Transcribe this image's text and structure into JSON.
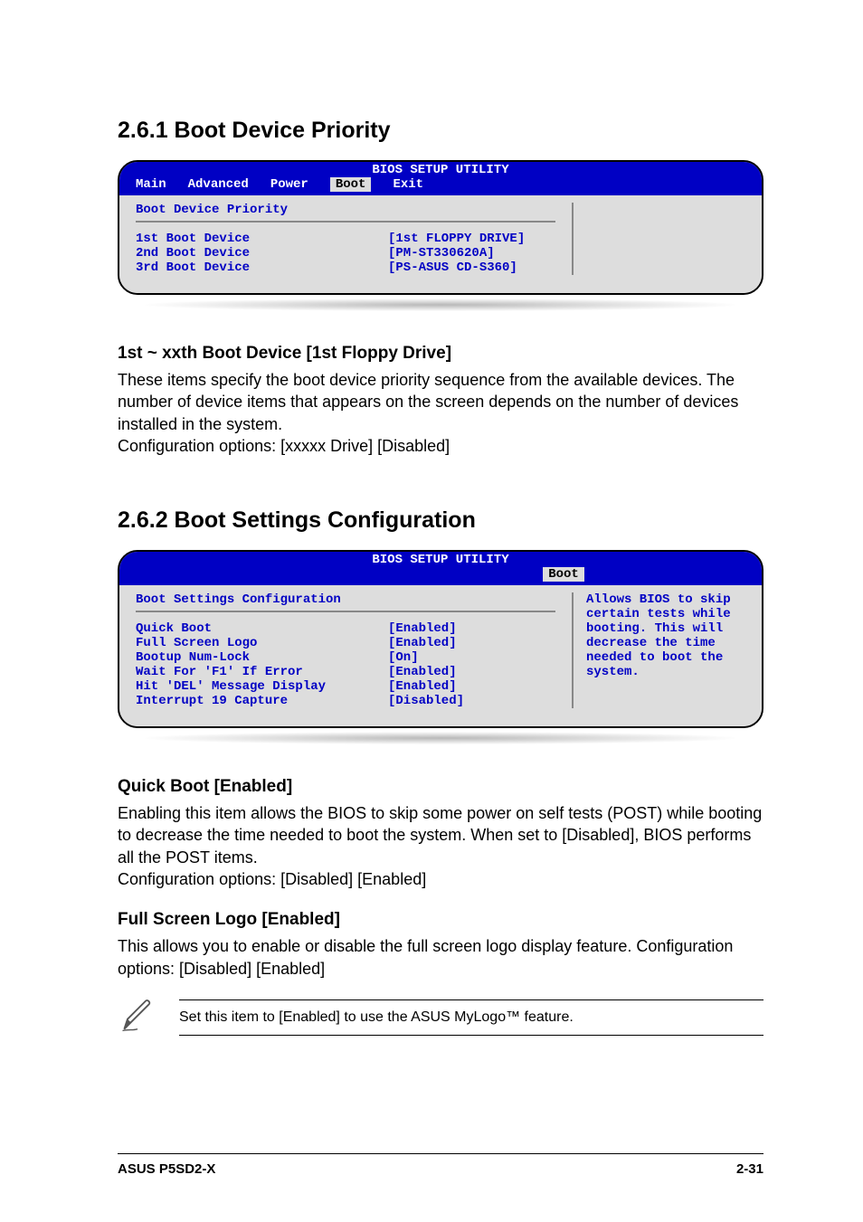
{
  "section1": {
    "heading": "2.6.1   Boot Device Priority",
    "bios": {
      "title": "BIOS SETUP UTILITY",
      "tabs": {
        "main": "Main",
        "advanced": "Advanced",
        "power": "Power",
        "boot": "Boot",
        "exit": "Exit"
      },
      "subtitle": "Boot Device Priority",
      "rows": [
        {
          "label": "1st Boot Device",
          "value": "[1st FLOPPY DRIVE]"
        },
        {
          "label": "2nd Boot Device",
          "value": "[PM-ST330620A]"
        },
        {
          "label": "3rd Boot Device",
          "value": "[PS-ASUS CD-S360]"
        }
      ]
    },
    "sub": {
      "heading": "1st ~ xxth Boot Device [1st Floppy Drive]",
      "body1": "These items specify the boot device priority sequence from the available devices. The number of device items that appears on the screen depends on the number of devices installed in the system.",
      "body2": "Configuration options: [xxxxx Drive] [Disabled]"
    }
  },
  "section2": {
    "heading": "2.6.2   Boot Settings Configuration",
    "bios": {
      "title": "BIOS SETUP UTILITY",
      "tab_boot": "Boot",
      "subtitle": "Boot Settings Configuration",
      "rows": [
        {
          "label": "Quick Boot",
          "value": "[Enabled]"
        },
        {
          "label": "Full Screen Logo",
          "value": "[Enabled]"
        },
        {
          "label": "Bootup Num-Lock",
          "value": "[On]"
        },
        {
          "label": "Wait For 'F1' If Error",
          "value": "[Enabled]"
        },
        {
          "label": "Hit 'DEL' Message Display",
          "value": "[Enabled]"
        },
        {
          "label": "Interrupt 19 Capture",
          "value": "[Disabled]"
        }
      ],
      "help": "Allows BIOS to skip certain tests while booting. This will decrease the time needed to boot the system."
    },
    "quick": {
      "heading": "Quick Boot [Enabled]",
      "body1": "Enabling this item allows the BIOS to skip some power on self tests (POST) while booting to decrease the time needed to boot the system. When set to [Disabled], BIOS performs all the POST items.",
      "body2": "Configuration options: [Disabled] [Enabled]"
    },
    "logo": {
      "heading": "Full Screen Logo [Enabled]",
      "body1": "This allows you to enable or disable the full screen logo display feature. Configuration options: [Disabled] [Enabled]"
    },
    "note": "Set this item to [Enabled] to use the ASUS MyLogo™ feature."
  },
  "footer": {
    "left": "ASUS P5SD2-X",
    "right": "2-31"
  }
}
